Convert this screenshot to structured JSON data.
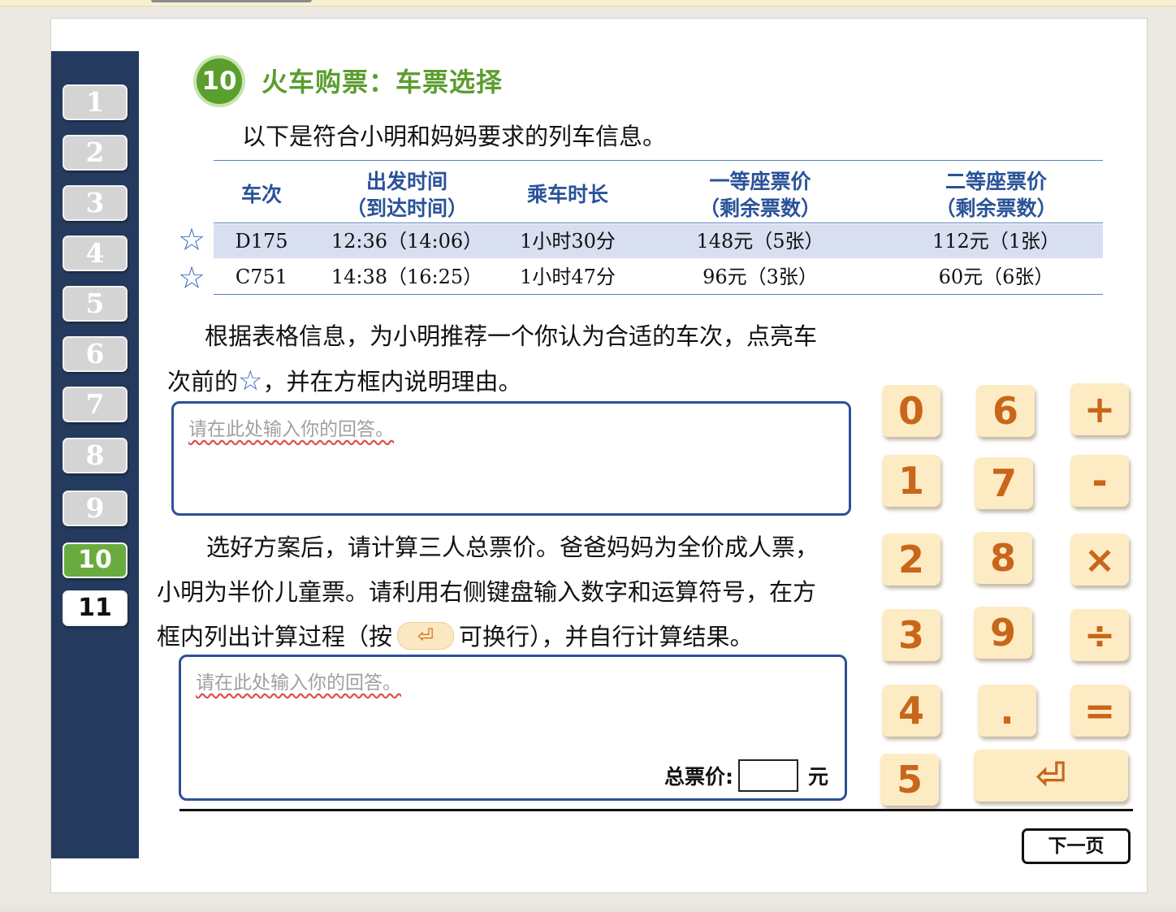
{
  "colors": {
    "accent_green": "#5a9e2d",
    "sidebar_bg": "#243a5e",
    "table_blue": "#2a5298",
    "key_bg": "#fdebc4",
    "key_text": "#c8661a"
  },
  "nav": {
    "items": [
      "1",
      "2",
      "3",
      "4",
      "5",
      "6",
      "7",
      "8",
      "9",
      "10",
      "11"
    ],
    "active": "10"
  },
  "header": {
    "number": "10",
    "title": "火车购票：车票选择"
  },
  "intro": "以下是符合小明和妈妈要求的列车信息。",
  "table": {
    "headers": [
      {
        "line1": "车次",
        "line2": ""
      },
      {
        "line1": "出发时间",
        "line2": "（到达时间）"
      },
      {
        "line1": "乘车时长",
        "line2": ""
      },
      {
        "line1": "一等座票价",
        "line2": "（剩余票数）"
      },
      {
        "line1": "二等座票价",
        "line2": "（剩余票数）"
      }
    ],
    "rows": [
      {
        "train": "D175",
        "time": "12:36（14:06）",
        "duration": "1小时30分",
        "first": "148元（5张）",
        "second": "112元（1张）"
      },
      {
        "train": "C751",
        "time": "14:38（16:25）",
        "duration": "1小时47分",
        "first": "96元（3张）",
        "second": "60元（6张）"
      }
    ],
    "star_icon": "☆"
  },
  "q1": {
    "line1": "根据表格信息，为小明推荐一个你认为合适的车次，点亮车",
    "line2a": "次前的",
    "line2b": "，并在方框内说明理由。",
    "placeholder": "请在此处输入你的回答。"
  },
  "q2": {
    "line1": "选好方案后，请计算三人总票价。爸爸妈妈为全价成人票，",
    "line2": "小明为半价儿童票。请利用右侧键盘输入数字和运算符号，在方",
    "line3a": "框内列出计算过程（按",
    "line3b": "可换行），并自行计算结果。",
    "placeholder": "请在此处输入你的回答。",
    "total_label": "总票价:",
    "total_unit": "元"
  },
  "keypad": {
    "col1": [
      "0",
      "1",
      "2",
      "3",
      "4",
      "5"
    ],
    "col2": [
      "6",
      "7",
      "8",
      "9",
      "."
    ],
    "col3": [
      "+",
      "-",
      "×",
      "÷",
      "="
    ],
    "enter_icon": "⏎"
  },
  "next_button": "下一页"
}
